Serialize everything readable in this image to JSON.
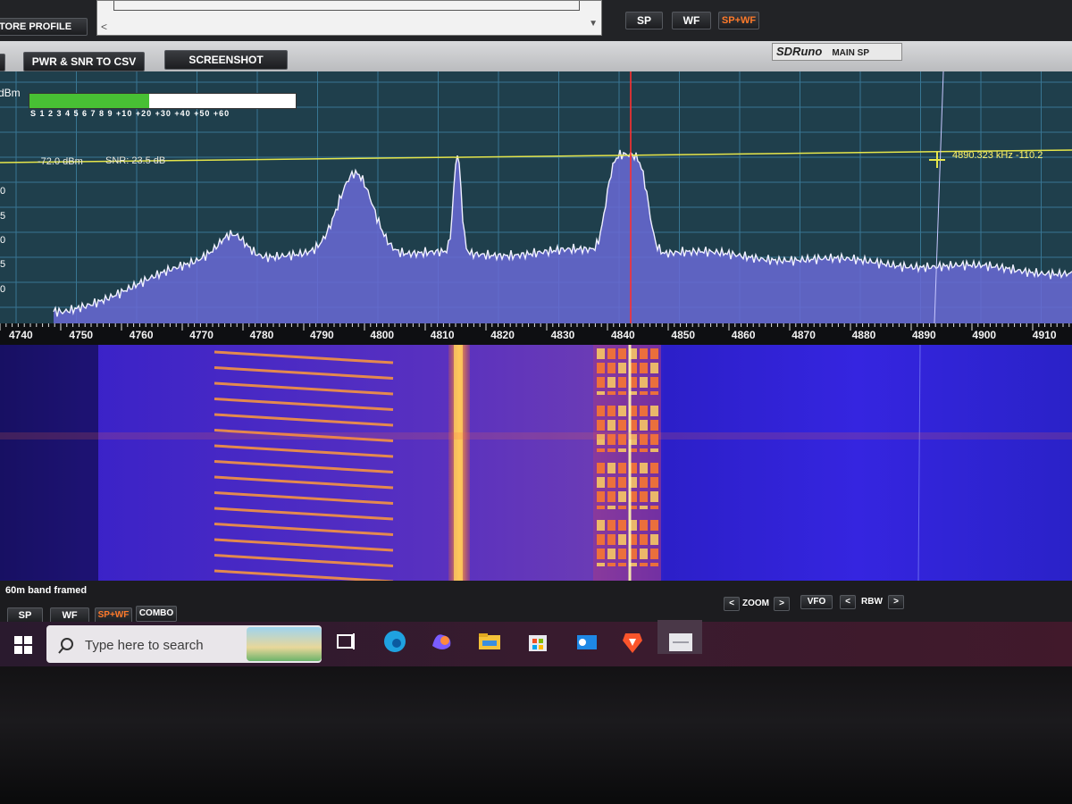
{
  "top_strip": {
    "store_profile_label": "TORE PROFILE",
    "view_buttons": {
      "sp": "SP",
      "wf": "WF",
      "spwf": "SP+WF"
    }
  },
  "toolbar": {
    "pwr_snr_csv_label": "PWR & SNR TO CSV",
    "screenshot_label": "SCREENSHOT",
    "app_logo": "SDRuno",
    "window_name": "MAIN SP"
  },
  "spectrum": {
    "dbm_label": "dBm",
    "smeter_scale": "S  1  2  3  4  5  6  7  8  9  +10 +20 +30 +40 +50 +60",
    "smeter_level": 0.45,
    "level_readout": "-72.0 dBm",
    "snr_readout": "SNR: 23.5 dB",
    "cursor_readout": "4890.323 kHz -110.2",
    "y_axis_partial_labels": [
      "0",
      "5",
      "0",
      "5",
      "0"
    ],
    "freq_labels": [
      "4740",
      "4750",
      "4760",
      "4770",
      "4780",
      "4790",
      "4800",
      "4810",
      "4820",
      "4830",
      "4840",
      "4850",
      "4860",
      "4870",
      "4880",
      "4890",
      "4900",
      "4910"
    ],
    "colors": {
      "background": "#1f3f4c",
      "grid": "#3b7c9b",
      "trace": "#f0f0ff",
      "fill": "#6a6ad6",
      "marker": "#ff3030",
      "level_line": "#e6e64a"
    }
  },
  "status": {
    "text": "60m band framed"
  },
  "bottom_buttons": {
    "sp": "SP",
    "wf": "WF",
    "spwf": "SP+WF",
    "combo": "COMBO",
    "zoom_label": "ZOOM",
    "vfo": "VFO",
    "rbw_label": "RBW",
    "left_arrow": "<",
    "right_arrow": ">"
  },
  "taskbar": {
    "search_placeholder": "Type here to search",
    "pinned_icons": [
      "task-view-icon",
      "edge-icon",
      "copilot-icon",
      "file-explorer-icon",
      "microsoft-store-icon",
      "outlook-icon",
      "brave-icon",
      "sdruno-app-icon"
    ]
  }
}
